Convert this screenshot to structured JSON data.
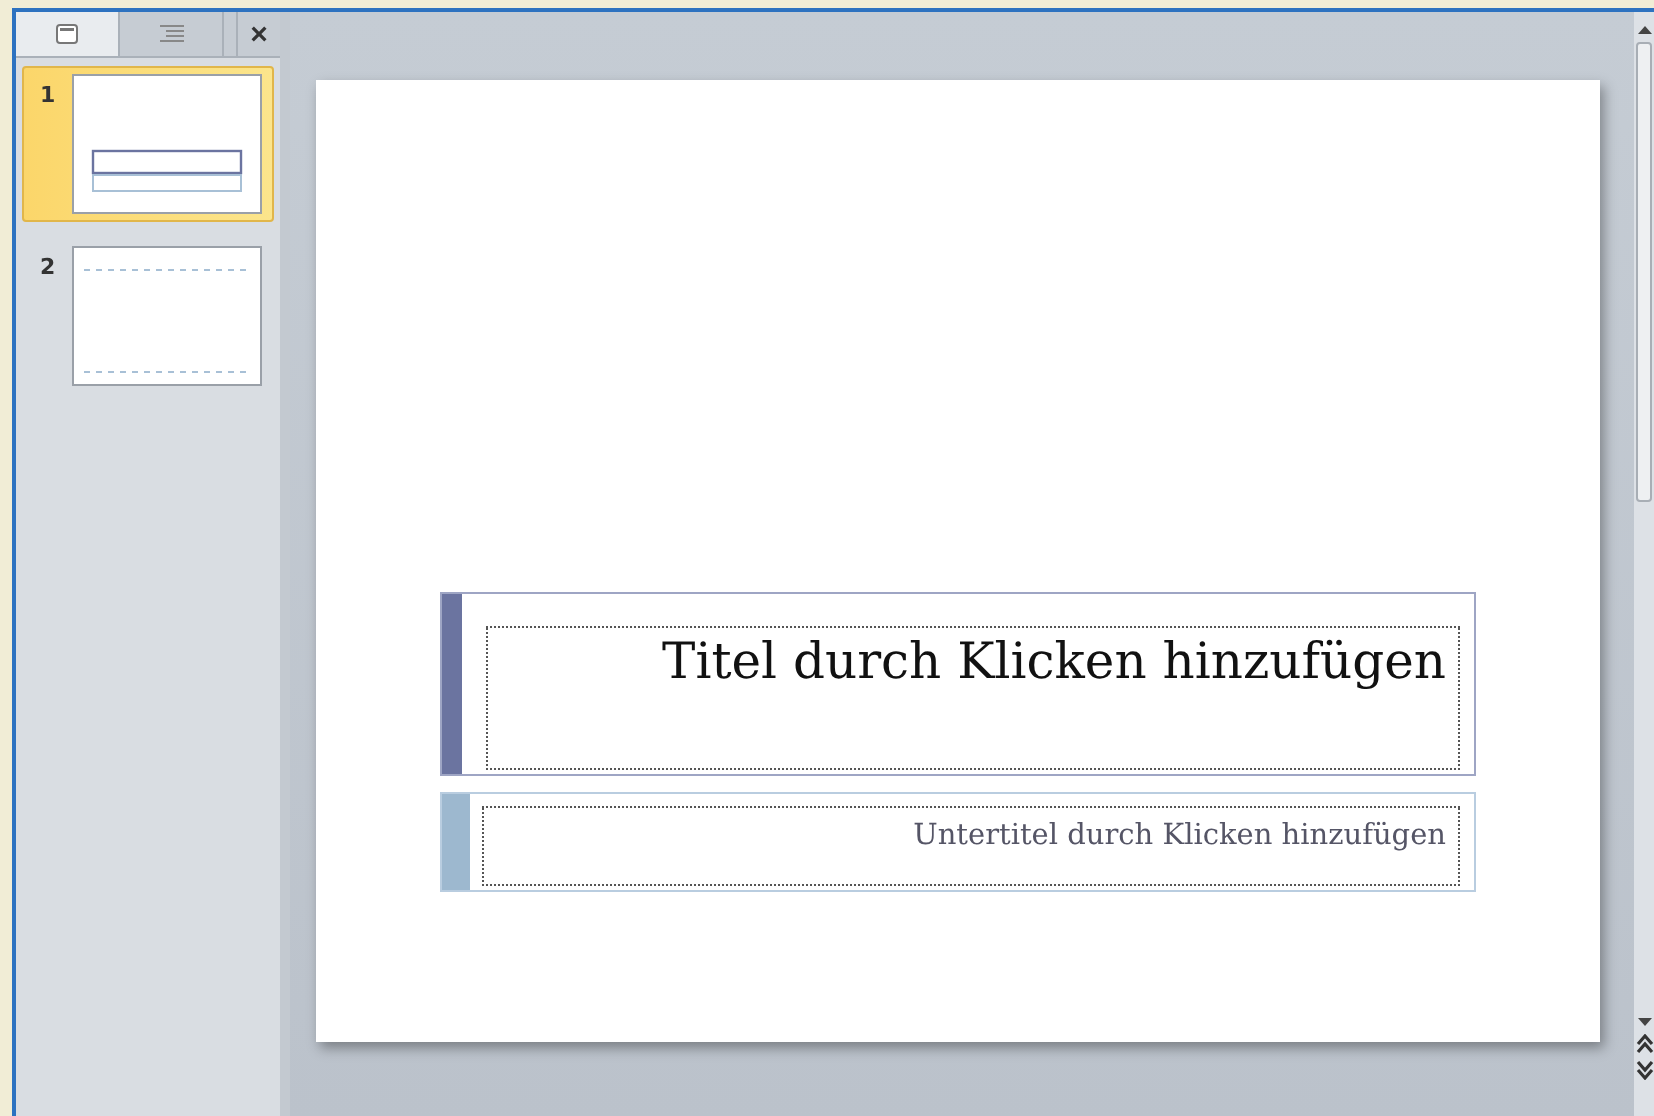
{
  "panel": {
    "tabs": [
      {
        "kind": "slides",
        "selected": true
      },
      {
        "kind": "outline",
        "selected": false
      }
    ],
    "close": "×",
    "thumbnails": [
      {
        "number": "1",
        "kind": "title",
        "selected": true
      },
      {
        "number": "2",
        "kind": "content",
        "selected": false
      }
    ]
  },
  "slide": {
    "title_placeholder": "Titel durch Klicken hinzufügen",
    "subtitle_placeholder": "Untertitel durch Klicken hinzufügen"
  }
}
